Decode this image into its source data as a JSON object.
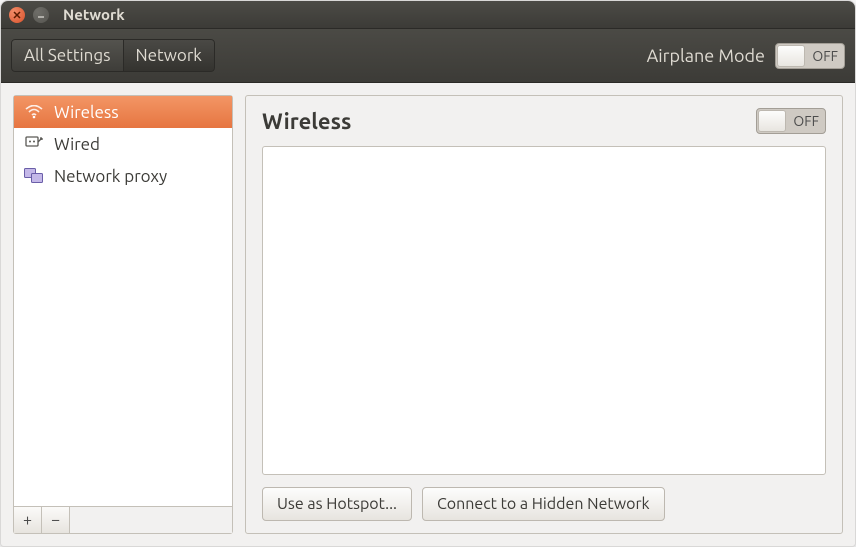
{
  "window": {
    "title": "Network"
  },
  "toolbar": {
    "crumbs": [
      "All Settings",
      "Network"
    ],
    "airplane_label": "Airplane Mode",
    "airplane_state": "OFF"
  },
  "sidebar": {
    "items": [
      {
        "icon": "wifi-icon",
        "label": "Wireless",
        "selected": true
      },
      {
        "icon": "wired-icon",
        "label": "Wired",
        "selected": false
      },
      {
        "icon": "proxy-icon",
        "label": "Network proxy",
        "selected": false
      }
    ],
    "add_label": "+",
    "remove_label": "−"
  },
  "content": {
    "title": "Wireless",
    "wireless_state": "OFF",
    "hotspot_label": "Use as Hotspot...",
    "hidden_label": "Connect to a Hidden Network"
  }
}
